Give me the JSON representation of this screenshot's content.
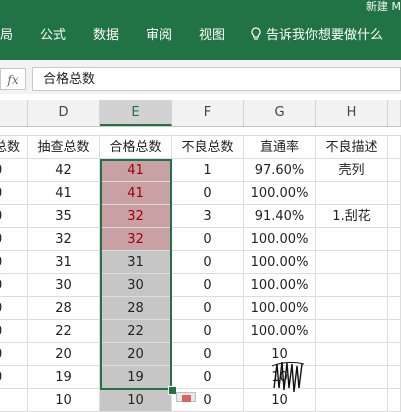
{
  "ribbon": {
    "title_partial": "新建 M",
    "tabs": [
      "局",
      "公式",
      "数据",
      "审阅",
      "视图"
    ],
    "tell_me": "告诉我你想要做什么"
  },
  "formula_bar": {
    "fx_label": "fx",
    "value": "合格总数"
  },
  "columns": [
    "D",
    "E",
    "F",
    "G",
    "H"
  ],
  "selected_column": "E",
  "header_row": [
    "总数",
    "抽查总数",
    "合格总数",
    "不良总数",
    "直通率",
    "不良描述"
  ],
  "rows": [
    [
      "0",
      "42",
      "41",
      "1",
      "97.60%",
      "壳列"
    ],
    [
      "0",
      "41",
      "41",
      "0",
      "100.00%",
      ""
    ],
    [
      "0",
      "35",
      "32",
      "3",
      "91.40%",
      "1.刮花"
    ],
    [
      "0",
      "32",
      "32",
      "0",
      "100.00%",
      ""
    ],
    [
      "0",
      "31",
      "31",
      "0",
      "100.00%",
      ""
    ],
    [
      "0",
      "30",
      "30",
      "0",
      "100.00%",
      ""
    ],
    [
      "0",
      "28",
      "28",
      "0",
      "100.00%",
      ""
    ],
    [
      "0",
      "22",
      "22",
      "0",
      "100.00%",
      ""
    ],
    [
      "0",
      "20",
      "20",
      "0",
      "10",
      ""
    ],
    [
      "0",
      "19",
      "19",
      "0",
      "10",
      ""
    ],
    [
      "",
      "10",
      "10",
      "0",
      "10",
      ""
    ]
  ],
  "colors": {
    "accent": "#217346",
    "dup_fill": "#c9a0a4",
    "dup_text": "#9c0006",
    "selection_fill": "#c6c6c6"
  },
  "highlighted_rows": [
    0,
    1,
    2,
    3
  ]
}
